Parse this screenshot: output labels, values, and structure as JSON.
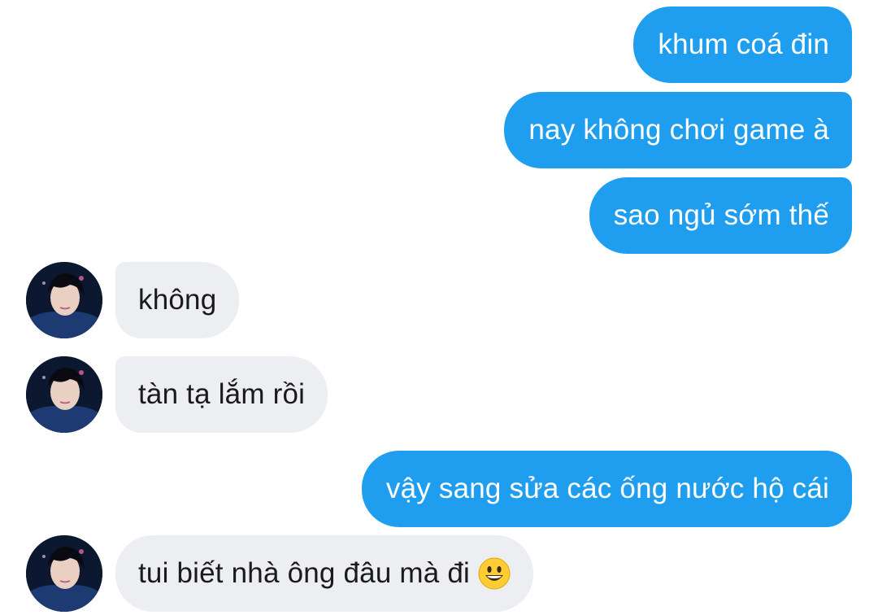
{
  "colors": {
    "outgoing_bubble": "#1f9ef0",
    "incoming_bubble": "#eceef1",
    "outgoing_text": "#ffffff",
    "incoming_text": "#1a1a1a"
  },
  "messages": [
    {
      "direction": "outgoing",
      "text": "khum coá đin"
    },
    {
      "direction": "outgoing",
      "text": "nay không chơi game à"
    },
    {
      "direction": "outgoing",
      "text": "sao ngủ sớm thế"
    },
    {
      "direction": "incoming",
      "text": "không",
      "avatar": "contact-avatar"
    },
    {
      "direction": "incoming",
      "text": "tàn tạ lắm rồi",
      "avatar": "contact-avatar"
    },
    {
      "direction": "outgoing",
      "text": "vậy sang sửa các ống nước hộ cái"
    },
    {
      "direction": "incoming",
      "text": "tui biết nhà ông đâu mà đi",
      "emoji": "grinning-face-emoji",
      "avatar": "contact-avatar"
    }
  ]
}
